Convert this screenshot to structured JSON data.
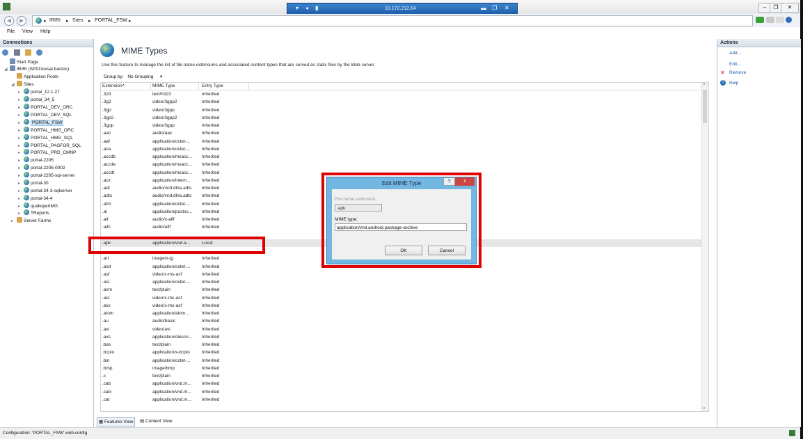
{
  "window": {
    "rdp_title": "10.172.212.64"
  },
  "address": {
    "crumbs": [
      "IRIRI",
      "Sites",
      "PORTAL_FSW"
    ]
  },
  "menu": [
    "File",
    "View",
    "Help"
  ],
  "connections": {
    "header": "Connections",
    "tree": [
      {
        "label": "Start Page",
        "level": 0,
        "icon": "start-page-icon"
      },
      {
        "label": "IRIRI (SP01\\cesar.bastos)",
        "level": 0,
        "icon": "server-icon"
      },
      {
        "label": "Application Pools",
        "level": 1,
        "icon": "app-pools-icon"
      },
      {
        "label": "Sites",
        "level": 1,
        "icon": "sites-folder-icon"
      },
      {
        "label": "portal_12.1.27",
        "level": 2,
        "icon": "site-globe-icon"
      },
      {
        "label": "portal_34_5",
        "level": 2,
        "icon": "site-globe-icon"
      },
      {
        "label": "PORTAL_DEV_ORC",
        "level": 2,
        "icon": "site-globe-icon"
      },
      {
        "label": "PORTAL_DEV_SQL",
        "level": 2,
        "icon": "site-globe-icon"
      },
      {
        "label": "PORTAL_FSW",
        "level": 2,
        "icon": "site-globe-icon",
        "selected": true
      },
      {
        "label": "PORTAL_HMG_ORC",
        "level": 2,
        "icon": "site-globe-icon"
      },
      {
        "label": "PORTAL_HMG_SQL",
        "level": 2,
        "icon": "site-globe-icon"
      },
      {
        "label": "PORTAL_PAGFOR_SQL",
        "level": 2,
        "icon": "site-globe-icon"
      },
      {
        "label": "PORTAL_PRD_CMNP",
        "level": 2,
        "icon": "site-globe-icon"
      },
      {
        "label": "portal-2205",
        "level": 2,
        "icon": "site-globe-icon"
      },
      {
        "label": "portal-2205-0002",
        "level": 2,
        "icon": "site-globe-icon"
      },
      {
        "label": "portal-2205-sql-server",
        "level": 2,
        "icon": "site-globe-icon"
      },
      {
        "label": "portal-30",
        "level": 2,
        "icon": "site-globe-icon"
      },
      {
        "label": "portal-34-3-sqlserver",
        "level": 2,
        "icon": "site-globe-icon"
      },
      {
        "label": "portal-34-4",
        "level": 2,
        "icon": "site-globe-icon"
      },
      {
        "label": "qualioperIMG",
        "level": 2,
        "icon": "site-globe-icon"
      },
      {
        "label": "TReports",
        "level": 2,
        "icon": "site-globe-icon"
      },
      {
        "label": "Server Farms",
        "level": 1,
        "icon": "server-farms-icon"
      }
    ]
  },
  "main": {
    "title": "MIME Types",
    "description": "Use this feature to manage the list of file name extensions and associated content types that are served as static files by the Web server.",
    "group_by_label": "Group by:",
    "group_by_value": "No Grouping",
    "columns": [
      "Extension",
      "MIME Type",
      "Entry Type"
    ],
    "rows": [
      [
        ".323",
        "text/h323",
        "Inherited"
      ],
      [
        ".3g2",
        "video/3gpp2",
        "Inherited"
      ],
      [
        ".3gp",
        "video/3gpp",
        "Inherited"
      ],
      [
        ".3gp2",
        "video/3gpp2",
        "Inherited"
      ],
      [
        ".3gpp",
        "video/3gpp",
        "Inherited"
      ],
      [
        ".aac",
        "audio/aac",
        "Inherited"
      ],
      [
        ".aaf",
        "application/octet-...",
        "Inherited"
      ],
      [
        ".aca",
        "application/octet-...",
        "Inherited"
      ],
      [
        ".accdb",
        "application/msacc...",
        "Inherited"
      ],
      [
        ".accde",
        "application/msacc...",
        "Inherited"
      ],
      [
        ".accdt",
        "application/msacc...",
        "Inherited"
      ],
      [
        ".acx",
        "application/intern...",
        "Inherited"
      ],
      [
        ".adt",
        "audio/vnd.dlna.adts",
        "Inherited"
      ],
      [
        ".adts",
        "audio/vnd.dlna.adts",
        "Inherited"
      ],
      [
        ".afm",
        "application/octet-...",
        "Inherited"
      ],
      [
        ".ai",
        "application/postsc...",
        "Inherited"
      ],
      [
        ".aif",
        "audio/x-aiff",
        "Inherited"
      ],
      [
        ".aifc",
        "audio/aiff",
        "Inherited"
      ],
      [
        "",
        "",
        ""
      ],
      [
        ".apk",
        "application/vnd.a...",
        "Local"
      ],
      [
        "",
        "",
        ""
      ],
      [
        ".art",
        "image/x-jg",
        "Inherited"
      ],
      [
        ".asd",
        "application/octet-...",
        "Inherited"
      ],
      [
        ".asf",
        "video/x-ms-asf",
        "Inherited"
      ],
      [
        ".asi",
        "application/octet-...",
        "Inherited"
      ],
      [
        ".asm",
        "text/plain",
        "Inherited"
      ],
      [
        ".asr",
        "video/x-ms-asf",
        "Inherited"
      ],
      [
        ".asx",
        "video/x-ms-asf",
        "Inherited"
      ],
      [
        ".atom",
        "application/atom...",
        "Inherited"
      ],
      [
        ".au",
        "audio/basic",
        "Inherited"
      ],
      [
        ".avi",
        "video/avi",
        "Inherited"
      ],
      [
        ".axs",
        "application/olescri...",
        "Inherited"
      ],
      [
        ".bas",
        "text/plain",
        "Inherited"
      ],
      [
        ".bcpio",
        "application/x-bcpio",
        "Inherited"
      ],
      [
        ".bin",
        "application/octet-...",
        "Inherited"
      ],
      [
        ".bmp",
        "image/bmp",
        "Inherited"
      ],
      [
        ".c",
        "text/plain",
        "Inherited"
      ],
      [
        ".cab",
        "application/vnd.m...",
        "Inherited"
      ],
      [
        ".calx",
        "application/vnd.m...",
        "Inherited"
      ],
      [
        ".cat",
        "application/vnd.m...",
        "Inherited"
      ]
    ],
    "tabs": [
      "Features View",
      "Content View"
    ]
  },
  "actions": {
    "header": "Actions",
    "items": [
      "Add...",
      "Edit...",
      "Remove",
      "Help"
    ]
  },
  "status": "Configuration: 'PORTAL_FSW' web.config",
  "dialog": {
    "title": "Edit MIME Type",
    "help_glyph": "?",
    "close_glyph": "x",
    "ext_label": "File name extension:",
    "ext_value": ".apk",
    "mime_label": "MIME type:",
    "mime_value": "application/vnd.android.package-archive",
    "ok": "OK",
    "cancel": "Cancel"
  },
  "colors": {
    "highlight_box": "#e00000",
    "dialog_frame": "#72b6e2",
    "link": "#1a5aa8"
  }
}
